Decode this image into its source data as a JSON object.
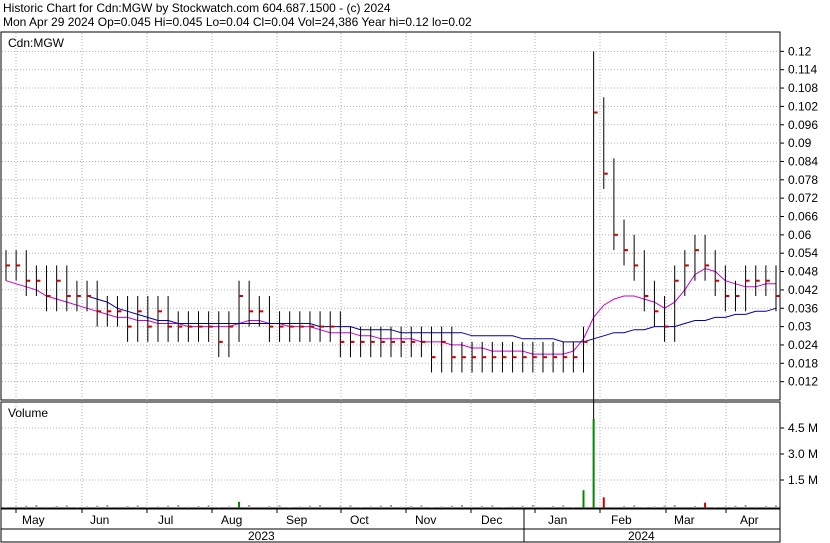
{
  "header": {
    "line1": "Historic Chart for Cdn:MGW by Stockwatch.com 604.687.1500 - (c) 2024",
    "line2": "Mon Apr 29 2024  Op=0.045  Hi=0.045  Lo=0.04  Cl=0.04  Vol=24,386  Year hi=0.12  lo=0.02"
  },
  "colors": {
    "price_bar": "#000000",
    "close_tick": "#cc0000",
    "ma_short": "#cc00cc",
    "ma_long": "#0000aa",
    "volume_up": "#008800",
    "volume_down": "#cc0000",
    "volume_flat": "#999999",
    "grid": "#b0b0b0"
  },
  "chart_data": [
    {
      "type": "ohlc",
      "title": "Cdn:MGW",
      "ylim": [
        0.006,
        0.126
      ],
      "yticks": [
        "0.12",
        "0.114",
        "0.108",
        "0.102",
        "0.096",
        "0.09",
        "0.084",
        "0.078",
        "0.072",
        "0.066",
        "0.06",
        "0.054",
        "0.048",
        "0.042",
        "0.036",
        "0.03",
        "0.024",
        "0.018",
        "0.012"
      ],
      "x_months": [
        "May",
        "Jun",
        "Jul",
        "Aug",
        "Sep",
        "Oct",
        "Nov",
        "Dec",
        "Jan",
        "Feb",
        "Mar",
        "Apr"
      ],
      "x_years": [
        "2023",
        "2024"
      ],
      "grid": true,
      "series": [
        {
          "name": "",
          "kind": "price",
          "values": [
            0.05,
            0.05,
            0.045,
            0.045,
            0.04,
            0.045,
            0.04,
            0.04,
            0.04,
            0.035,
            0.035,
            0.035,
            0.03,
            0.035,
            0.03,
            0.035,
            0.03,
            0.03,
            0.03,
            0.03,
            0.03,
            0.025,
            0.03,
            0.04,
            0.035,
            0.035,
            0.03,
            0.03,
            0.03,
            0.03,
            0.03,
            0.03,
            0.03,
            0.025,
            0.025,
            0.025,
            0.025,
            0.025,
            0.025,
            0.025,
            0.025,
            0.025,
            0.02,
            0.025,
            0.02,
            0.02,
            0.02,
            0.02,
            0.02,
            0.02,
            0.02,
            0.02,
            0.02,
            0.02,
            0.02,
            0.02,
            0.02,
            0.025,
            0.1,
            0.08,
            0.06,
            0.055,
            0.05,
            0.04,
            0.035,
            0.03,
            0.045,
            0.05,
            0.055,
            0.05,
            0.045,
            0.04,
            0.04,
            0.045,
            0.045,
            0.045,
            0.04
          ]
        },
        {
          "name": "",
          "kind": "ma_short",
          "values": [
            0.045,
            0.044,
            0.043,
            0.042,
            0.04,
            0.039,
            0.038,
            0.037,
            0.036,
            0.035,
            0.034,
            0.033,
            0.033,
            0.032,
            0.032,
            0.031,
            0.031,
            0.031,
            0.03,
            0.03,
            0.03,
            0.03,
            0.03,
            0.031,
            0.032,
            0.032,
            0.031,
            0.031,
            0.03,
            0.03,
            0.03,
            0.029,
            0.028,
            0.028,
            0.028,
            0.027,
            0.027,
            0.026,
            0.026,
            0.026,
            0.026,
            0.025,
            0.025,
            0.025,
            0.024,
            0.024,
            0.023,
            0.023,
            0.022,
            0.022,
            0.022,
            0.022,
            0.021,
            0.021,
            0.021,
            0.021,
            0.022,
            0.026,
            0.033,
            0.037,
            0.039,
            0.04,
            0.04,
            0.039,
            0.038,
            0.036,
            0.038,
            0.042,
            0.047,
            0.049,
            0.048,
            0.045,
            0.044,
            0.043,
            0.043,
            0.044,
            0.044
          ]
        },
        {
          "name": "",
          "kind": "ma_long",
          "values": [
            null,
            null,
            null,
            null,
            null,
            null,
            null,
            null,
            0.04,
            0.039,
            0.038,
            0.036,
            0.035,
            0.034,
            0.033,
            0.032,
            0.032,
            0.031,
            0.031,
            0.031,
            0.031,
            0.031,
            0.031,
            0.031,
            0.031,
            0.031,
            0.031,
            0.031,
            0.031,
            0.031,
            0.031,
            0.03,
            0.03,
            0.03,
            0.03,
            0.029,
            0.029,
            0.029,
            0.029,
            0.028,
            0.028,
            0.028,
            0.028,
            0.028,
            0.028,
            0.028,
            0.027,
            0.027,
            0.027,
            0.027,
            0.027,
            0.026,
            0.026,
            0.026,
            0.026,
            0.025,
            0.025,
            0.025,
            0.026,
            0.027,
            0.028,
            0.028,
            0.029,
            0.029,
            0.03,
            0.03,
            0.03,
            0.031,
            0.032,
            0.032,
            0.033,
            0.033,
            0.034,
            0.034,
            0.035,
            0.035,
            0.036
          ]
        }
      ]
    },
    {
      "type": "bar",
      "title": "Volume",
      "yticks": [
        "4.5 M",
        "3.0 M",
        "1.5 M"
      ],
      "ylim": [
        0,
        5.4
      ],
      "unit": "M"
    }
  ]
}
